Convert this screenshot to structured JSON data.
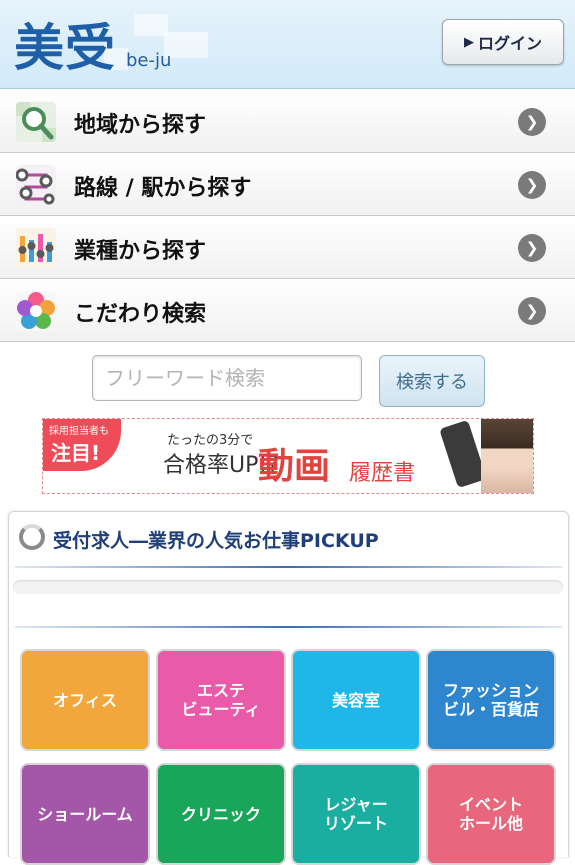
{
  "header": {
    "logo_main": "美受",
    "logo_sub": "be-ju",
    "login_label": "ログイン"
  },
  "menu": [
    {
      "label": "地域から探す",
      "icon": "map-search-icon"
    },
    {
      "label": "路線 / 駅から探す",
      "icon": "train-route-icon"
    },
    {
      "label": "業種から探す",
      "icon": "industry-bars-icon"
    },
    {
      "label": "こだわり検索",
      "icon": "flower-icon"
    }
  ],
  "search": {
    "placeholder": "フリーワード検索",
    "button_label": "検索する"
  },
  "banner": {
    "badge_small": "採用担当者も",
    "badge_big": "注目!",
    "line_small": "たったの3分で",
    "line_mid": "合格率UP!?",
    "line_big": "動画",
    "line_tail": "履歴書"
  },
  "pickup": {
    "title": "受付求人―業界の人気お仕事PICKUP"
  },
  "categories": [
    {
      "label": "オフィス",
      "color": "#f2a73c"
    },
    {
      "label": "エステ\nビューティ",
      "color": "#e95aa8"
    },
    {
      "label": "美容室",
      "color": "#1fb6e8"
    },
    {
      "label": "ファッション\nビル・百貨店",
      "color": "#2e86cf"
    },
    {
      "label": "ショールーム",
      "color": "#a456a8"
    },
    {
      "label": "クリニック",
      "color": "#19a65a"
    },
    {
      "label": "レジャー\nリゾート",
      "color": "#1aaea0"
    },
    {
      "label": "イベント\nホール他",
      "color": "#e8677c"
    }
  ]
}
